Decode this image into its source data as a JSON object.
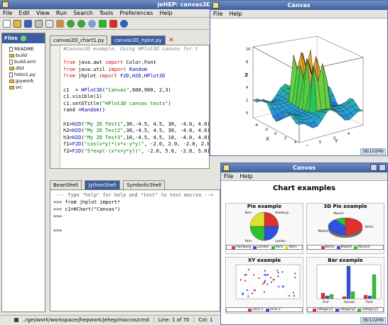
{
  "ide": {
    "title": "jeHEP: canvas3D_hplot",
    "menu": [
      "File",
      "Edit",
      "View",
      "Run",
      "Search",
      "Tools",
      "Preferences",
      "Help"
    ],
    "sidebar_tab": "Files",
    "files": [
      "README",
      "build",
      "build.xml",
      "dist",
      "histo1.py",
      "jpywork",
      "src"
    ],
    "editor_tabs": [
      "canvas2D_chart1.py",
      "canvas3D_hplot.py"
    ],
    "code_lines": [
      "#Canvas3D example. Using HPlot3D canvas for t",
      "",
      "from java.awt import Color,Font",
      "from java.util import Random",
      "from jhplot import F2D,H2D,HPlot3D",
      "",
      "c1  = HPlot3D(\"Canvas\",600,900, 2,3)",
      "c1.visible(1)",
      "c1.setGTitle(\"HPlot3D canvas tests\")",
      "rand =Random()",
      "",
      "h1=H2D(\"My 2D Test1\",30,-4.5, 4.5, 30, -4.0, 4.0)",
      "h2=H2D(\"My 2D Test2\",30,-4.5, 4.5, 30, -4.0, 4.0)",
      "h3=H2D(\"My 2D Test3\",10,-4.5, 4.5, 10, -4.0, 4.0)",
      "f1=F2D(\"cos(x*y)*(x*x-y*y)\", -2.0, 2.0, -2.0, 2.0)",
      "f2=F2D(\"5*exp(-(x*x+y*y))\", -2.0, 5.0, -2.0, 5.0)"
    ],
    "shell_tabs": [
      "BeanShell",
      "JythonShell",
      "SymbolicShell"
    ],
    "shell_lines": [
      "--- Type \"help\" for help and \"test\" to test macros -->",
      ">>> from jhplot import*",
      ">>> c1=HChart(\"Canvas\")",
      ">>>",
      "",
      ">>>"
    ],
    "status_path": "..rgei/work/workspace/jhepwork/jehep/macros/cmd",
    "status_line": "Line: 1 of 70",
    "status_col": "Col: 1"
  },
  "canvas3d": {
    "title": "Canvas",
    "menu": [
      "File",
      "Help"
    ],
    "memory": "38/102Mb",
    "axis_z": "Z",
    "axis_x": "X",
    "axis_y": "Y",
    "z_ticks": [
      "10",
      "8",
      "6",
      "4",
      "2",
      "0"
    ],
    "x_ticks": [
      "-4",
      "-2",
      "0",
      "2",
      "4"
    ],
    "y_ticks": [
      "-2",
      "0",
      "2",
      "4"
    ]
  },
  "chartwin": {
    "title": "Canvas",
    "menu": [
      "File",
      "Help"
    ],
    "memory": "38/102Mb",
    "heading": "Chart examples",
    "pie": {
      "title": "Pie example",
      "labels": [
        "Hamburg",
        "London",
        "Paris",
        "Bern"
      ],
      "colors": [
        "#e03030",
        "#3050e0",
        "#30c030",
        "#e0e030"
      ],
      "values": [
        25,
        25,
        25,
        25
      ]
    },
    "pie3d": {
      "title": "3D Pie example",
      "labels": [
        "Berlin",
        "Madrid",
        "Munich"
      ],
      "colors": [
        "#e03030",
        "#3050e0",
        "#30c030"
      ],
      "values": [
        50,
        40,
        10
      ]
    },
    "xy": {
      "title": "XY example",
      "legend": [
        "serie 1",
        "serie 2"
      ],
      "colors": [
        "#e03030",
        "#3050e0"
      ]
    },
    "bar": {
      "title": "Bar example",
      "legend": [
        "category1",
        "category2",
        "category3"
      ],
      "colors": [
        "#e03030",
        "#3050e0",
        "#30c030"
      ],
      "x_labels": [
        "First",
        "Second",
        "Third"
      ]
    }
  }
}
